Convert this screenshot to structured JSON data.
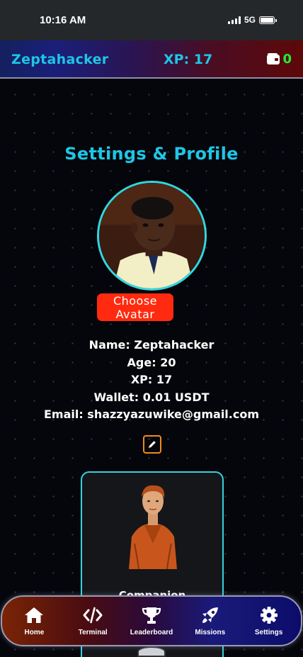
{
  "status_bar": {
    "time": "10:16 AM",
    "network": "5G"
  },
  "header": {
    "brand": "Zeptahacker",
    "xp": "XP: 17",
    "wallet_count": "0"
  },
  "page": {
    "title": "Settings & Profile",
    "choose_avatar_label": "Choose Avatar",
    "profile": {
      "name": "Name: Zeptahacker",
      "age": "Age: 20",
      "xp": "XP: 17",
      "wallet": "Wallet: 0.01 USDT",
      "email": "Email: shazzyazuwike@gmail.com"
    },
    "companion_label": "Companion"
  },
  "nav": {
    "items": [
      {
        "label": "Home",
        "icon": "home-icon"
      },
      {
        "label": "Terminal",
        "icon": "code-icon"
      },
      {
        "label": "Leaderboard",
        "icon": "trophy-icon"
      },
      {
        "label": "Missions",
        "icon": "rocket-icon"
      },
      {
        "label": "Settings",
        "icon": "gear-icon"
      }
    ]
  },
  "colors": {
    "accent_cyan": "#1ec6e6",
    "wallet_green": "#22ee33",
    "avatar_button": "#ff2a0f",
    "edit_border": "#f08a1a"
  }
}
